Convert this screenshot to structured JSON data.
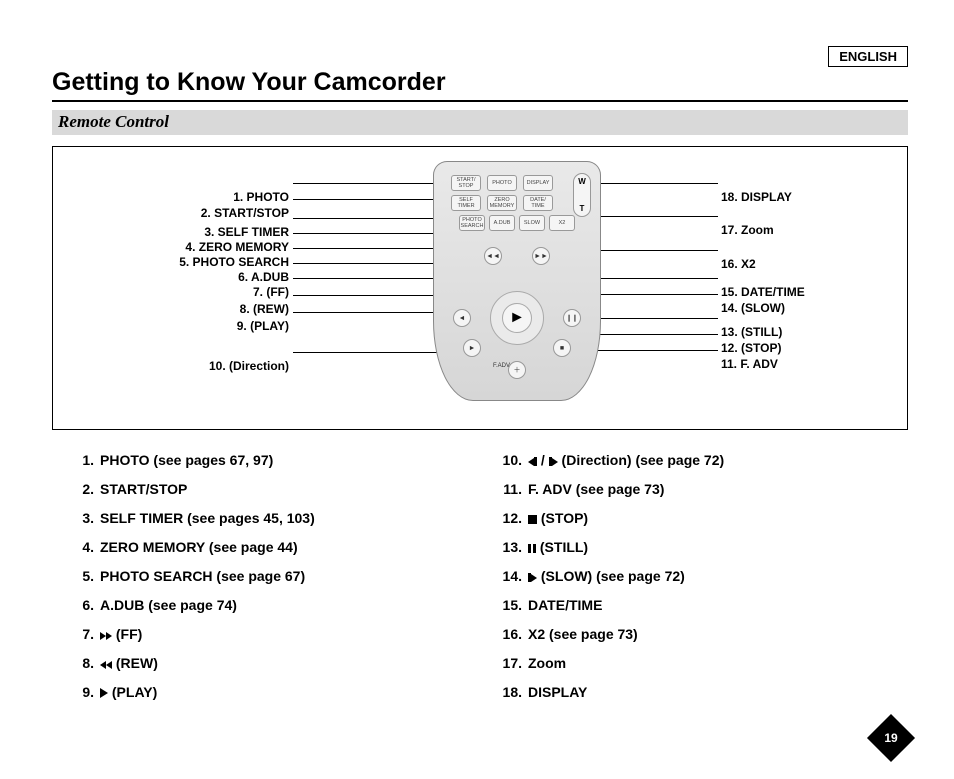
{
  "language_label": "ENGLISH",
  "title": "Getting to Know Your Camcorder",
  "subtitle": "Remote Control",
  "page_number": "19",
  "diagram": {
    "left_labels": [
      "1. PHOTO",
      "2. START/STOP",
      "3. SELF TIMER",
      "4. ZERO MEMORY",
      "5. PHOTO SEARCH",
      "6. A.DUB",
      "7.     (FF)",
      "8.      (REW)",
      "9.     (PLAY)",
      "10.          (Direction)"
    ],
    "right_labels": [
      "18. DISPLAY",
      "17. Zoom",
      "16. X2",
      "15. DATE/TIME",
      "14.      (SLOW)",
      "13.     (STILL)",
      "12.     (STOP)",
      "11. F. ADV"
    ],
    "remote_row1": [
      "START/\nSTOP",
      "PHOTO",
      "DISPLAY"
    ],
    "remote_row2": [
      "SELF\nTIMER",
      "ZERO\nMEMORY",
      "DATE/\nTIME"
    ],
    "remote_row3": [
      "PHOTO\nSEARCH",
      "A.DUB",
      "SLOW",
      "X2"
    ],
    "fadv": "F.ADV",
    "wt_top": "W",
    "wt_bot": "T"
  },
  "list_left": [
    {
      "n": "1.",
      "t": "PHOTO (see pages 67, 97)"
    },
    {
      "n": "2.",
      "t": "START/STOP"
    },
    {
      "n": "3.",
      "t": "SELF TIMER (see pages 45, 103)"
    },
    {
      "n": "4.",
      "t": "ZERO MEMORY (see page 44)"
    },
    {
      "n": "5.",
      "t": "PHOTO SEARCH (see page 67)"
    },
    {
      "n": "6.",
      "t": "A.DUB (see page 74)"
    },
    {
      "n": "7.",
      "t": "(FF)",
      "icon": "ff"
    },
    {
      "n": "8.",
      "t": "(REW)",
      "icon": "rew"
    },
    {
      "n": "9.",
      "t": "(PLAY)",
      "icon": "play"
    }
  ],
  "list_right": [
    {
      "n": "10.",
      "t": "(Direction) (see page 72)",
      "icon": "dir"
    },
    {
      "n": "11.",
      "t": "F. ADV  (see page 73)"
    },
    {
      "n": "12.",
      "t": "(STOP)",
      "icon": "stop"
    },
    {
      "n": "13.",
      "t": "(STILL)",
      "icon": "still"
    },
    {
      "n": "14.",
      "t": "(SLOW) (see page 72)",
      "icon": "slow"
    },
    {
      "n": "15.",
      "t": "DATE/TIME"
    },
    {
      "n": "16.",
      "t": "X2 (see page 73)"
    },
    {
      "n": "17.",
      "t": "Zoom"
    },
    {
      "n": "18.",
      "t": "DISPLAY"
    }
  ]
}
